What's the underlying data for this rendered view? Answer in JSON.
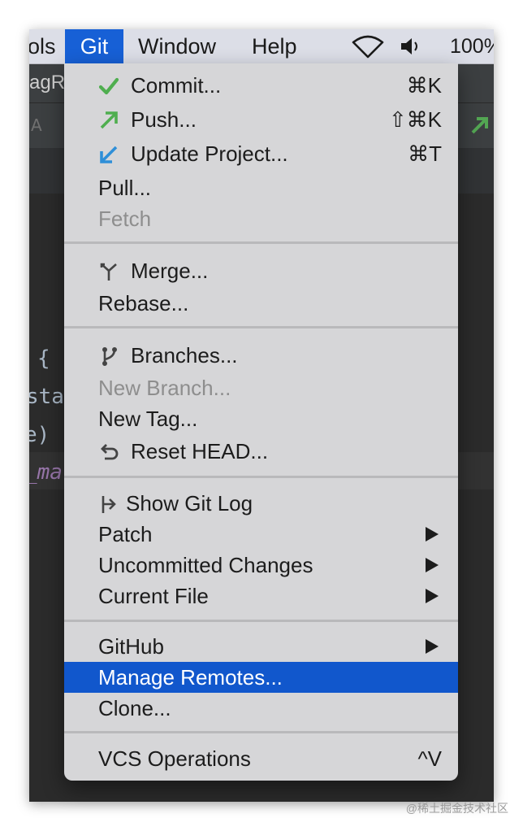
{
  "menubar": {
    "items": [
      {
        "label": "ols"
      },
      {
        "label": "Git"
      },
      {
        "label": "Window"
      },
      {
        "label": "Help"
      }
    ],
    "status": {
      "wifi_icon": "wifi-icon",
      "volume_icon": "volume-icon",
      "battery": "100%"
    }
  },
  "background": {
    "tab_fragment": "agRe",
    "code_lines": [
      "{",
      "stat",
      "e)",
      "_ma"
    ]
  },
  "git_menu": {
    "items": [
      {
        "label": "Commit...",
        "shortcut": "⌘K",
        "icon": "checkmark-icon"
      },
      {
        "label": "Push...",
        "shortcut": "⇧⌘K",
        "icon": "push-arrow-icon"
      },
      {
        "label": "Update Project...",
        "shortcut": "⌘T",
        "icon": "update-arrow-icon"
      },
      {
        "label": "Pull..."
      },
      {
        "label": "Fetch",
        "disabled": true
      },
      {
        "label": "Merge...",
        "icon": "merge-icon"
      },
      {
        "label": "Rebase..."
      },
      {
        "label": "Branches...",
        "icon": "branch-icon"
      },
      {
        "label": "New Branch...",
        "disabled": true
      },
      {
        "label": "New Tag..."
      },
      {
        "label": "Reset HEAD...",
        "icon": "undo-icon"
      },
      {
        "label": "Show Git Log",
        "icon": "git-log-icon"
      },
      {
        "label": "Patch",
        "submenu": true
      },
      {
        "label": "Uncommitted Changes",
        "submenu": true
      },
      {
        "label": "Current File",
        "submenu": true
      },
      {
        "label": "GitHub",
        "submenu": true
      },
      {
        "label": "Manage Remotes...",
        "highlighted": true
      },
      {
        "label": "Clone..."
      },
      {
        "label": "VCS Operations",
        "shortcut": "^V"
      }
    ]
  },
  "watermark": "@稀土掘金技术社区",
  "colors": {
    "highlight": "#1157cc",
    "menu_bg": "#d6d6d8",
    "check_green": "#4fae4f",
    "update_blue": "#2f8fd8"
  }
}
